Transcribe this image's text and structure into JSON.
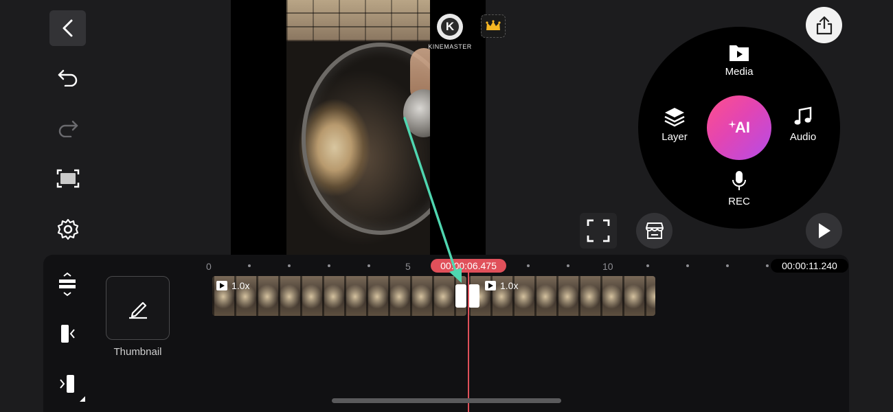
{
  "app": {
    "brand_label": "KINEMASTER",
    "brand_logo_letter": "K"
  },
  "left_toolbar": {
    "icons": [
      "back-icon",
      "undo-icon",
      "redo-icon",
      "aspect-ratio-icon",
      "settings-icon"
    ]
  },
  "radial_menu": {
    "media_label": "Media",
    "layer_label": "Layer",
    "audio_label": "Audio",
    "rec_label": "REC",
    "ai_label": "AI"
  },
  "timeline": {
    "thumbnail_label": "Thumbnail",
    "ruler_labels": [
      "0",
      "5",
      "10"
    ],
    "current_time": "00:00:06.475",
    "total_time": "00:00:11.240",
    "clips": [
      {
        "speed": "1.0x"
      },
      {
        "speed": "1.0x"
      }
    ]
  },
  "colors": {
    "playhead": "#e0505a",
    "ai_gradient_start": "#ff4f8b",
    "ai_gradient_end": "#b54ce8",
    "annotation_arrow": "#4fd6b0"
  }
}
